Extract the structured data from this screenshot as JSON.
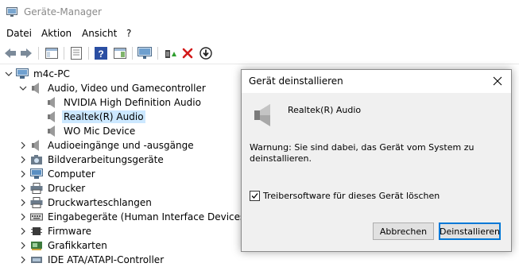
{
  "window": {
    "title": "Geräte-Manager"
  },
  "menu": [
    "Datei",
    "Aktion",
    "Ansicht",
    "?"
  ],
  "toolbar": {
    "buttons": [
      "back-icon",
      "forward-icon",
      "properties-icon",
      "help-icon",
      "update-driver-icon",
      "scan-hardware-icon",
      "uninstall-icon",
      "disable-icon",
      "download-icon"
    ]
  },
  "tree": {
    "root": "m4c-PC",
    "audio": "Audio, Video und Gamecontroller",
    "audio_children": [
      "NVIDIA High Definition Audio",
      "Realtek(R) Audio",
      "WO Mic Device"
    ],
    "categories": [
      "Audioeingänge und -ausgänge",
      "Bildverarbeitungsgeräte",
      "Computer",
      "Drucker",
      "Druckwarteschlangen",
      "Eingabegeräte (Human Interface Devices)",
      "Firmware",
      "Grafikkarten",
      "IDE ATA/ATAPI-Controller"
    ],
    "selected": "Realtek(R) Audio"
  },
  "dialog": {
    "title": "Gerät deinstallieren",
    "device_name": "Realtek(R) Audio",
    "warning": "Warnung: Sie sind dabei, das Gerät vom System zu deinstallieren.",
    "checkbox_label": "Treibersoftware für dieses Gerät löschen",
    "checkbox_checked": true,
    "cancel_label": "Abbrechen",
    "confirm_label": "Deinstallieren"
  },
  "colors": {
    "selection": "#cce8ff",
    "accent": "#0078d7",
    "dialog_bg": "#f0f0f0"
  }
}
